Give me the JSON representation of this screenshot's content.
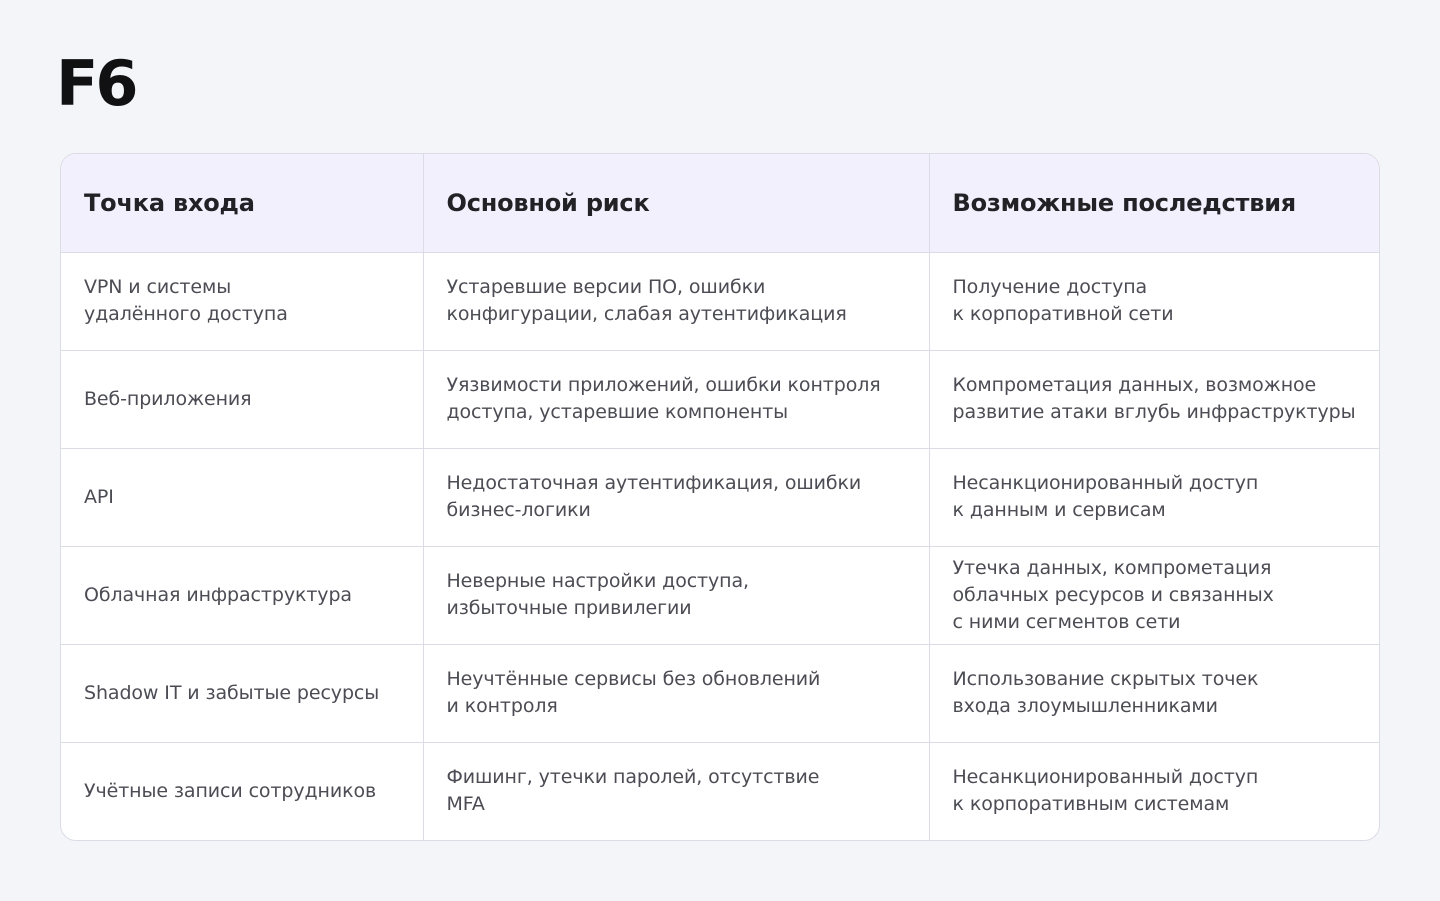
{
  "brand": {
    "logo_text": "F6"
  },
  "table": {
    "headers": [
      "Точка входа",
      "Основной риск",
      "Возможные последствия"
    ],
    "rows": [
      [
        "VPN и системы\nудалённого доступа",
        "Устаревшие версии ПО, ошибки\nконфигурации, слабая аутентификация",
        "Получение доступа\nк корпоративной сети"
      ],
      [
        "Веб-приложения",
        "Уязвимости приложений, ошибки контроля\nдоступа, устаревшие компоненты",
        "Компрометация данных, возможное\nразвитие атаки вглубь инфраструктуры"
      ],
      [
        "API",
        "Недостаточная аутентификация, ошибки\nбизнес-логики",
        "Несанкционированный доступ\nк данным и сервисам"
      ],
      [
        "Облачная инфраструктура",
        "Неверные настройки доступа,\nизбыточные привилегии",
        "Утечка данных, компрометация\nоблачных ресурсов и связанных\nс ними сегментов сети"
      ],
      [
        "Shadow IT и забытые ресурсы",
        "Неучтённые сервисы без обновлений\nи контроля",
        "Использование скрытых точек\nвхода злоумышленниками"
      ],
      [
        "Учётные записи сотрудников",
        "Фишинг, утечки паролей, отсутствие\nMFA",
        "Несанкционированный доступ\nк корпоративным системам"
      ]
    ]
  }
}
